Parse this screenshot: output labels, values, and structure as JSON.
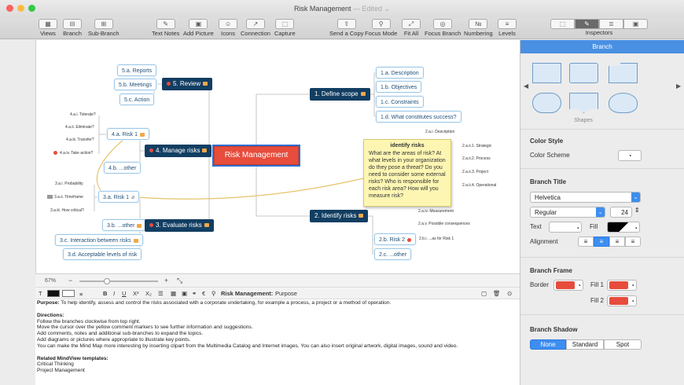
{
  "window": {
    "title": "Risk Management",
    "edited": "— Edited ⌄"
  },
  "toolbar": {
    "left": [
      {
        "id": "views",
        "label": "Views",
        "icon": "▦"
      },
      {
        "id": "branch",
        "label": "Branch",
        "icon": "⊟"
      },
      {
        "id": "sub-branch",
        "label": "Sub-Branch",
        "icon": "⊞"
      }
    ],
    "mid": [
      {
        "id": "text-notes",
        "label": "Text Notes",
        "icon": "✎"
      },
      {
        "id": "add-picture",
        "label": "Add Picture",
        "icon": "▣"
      },
      {
        "id": "icons",
        "label": "Icons",
        "icon": "☺"
      },
      {
        "id": "connection",
        "label": "Connection",
        "icon": "↗"
      },
      {
        "id": "capture",
        "label": "Capture",
        "icon": "⬚"
      }
    ],
    "right": [
      {
        "id": "send-copy",
        "label": "Send a Copy",
        "icon": "⇪"
      },
      {
        "id": "focus-mode",
        "label": "Focus Mode",
        "icon": "⚲"
      },
      {
        "id": "fit-all",
        "label": "Fit All",
        "icon": "⤢"
      },
      {
        "id": "focus-branch",
        "label": "Focus Branch",
        "icon": "◎"
      },
      {
        "id": "numbering",
        "label": "Numbering",
        "icon": "№"
      },
      {
        "id": "levels",
        "label": "Levels",
        "icon": "≡"
      }
    ],
    "inspectors": {
      "label": "Inspectors",
      "icons": [
        "⬚",
        "✎",
        "≣",
        "▣"
      ]
    }
  },
  "map": {
    "central": "Risk Management",
    "main_branches": {
      "b5": "5.  Review",
      "b1": "1.  Define scope",
      "b4": "4.  Manage risks",
      "b2": "2.  Identify risks",
      "b3": "3.  Evaluate risks"
    },
    "subs": {
      "s5a": "5.a.  Reports",
      "s5b": "5.b.  Meetings",
      "s5c": "5.c.  Action",
      "s1a": "1.a.  Description",
      "s1b": "1.b.  Objectives",
      "s1c": "1.c.  Constraints",
      "s1d": "1.d.  What constitutes success?",
      "s4a": "4.a.  Risk 1",
      "s4b": "4.b.  ...other",
      "s3a": "3.a.  Risk 1",
      "s3b": "3.b.  ...other",
      "s3c": "3.c.  Interaction between risks",
      "s3d": "3.d.  Acceptable levels of risk",
      "s2b": "2.b.  Risk 2",
      "s2c": "2.c.  ...other"
    },
    "tiny": {
      "t4ai": "4.a.i.  Tolerate?",
      "t4aii": "4.a.ii.  Eliminate?",
      "t4aiii": "4.a.iii.  Transfer?",
      "t4aiv": "4.a.iv.  Take action?",
      "t3ai": "3.a.i.  Probability",
      "t3aii": "3.a.ii.  Timeframe",
      "t3aiii": "3.a.iii.  How critical?",
      "t2ai": "2.a.i.  Description",
      "t2aii1": "2.a.ii.1. Strategic",
      "t2aii2": "2.a.ii.2. Process",
      "t2aii3": "2.a.ii.3. Project",
      "t2aii4": "2.a.ii.4. Operational",
      "t2aiv": "2.a.iv.  Measurement",
      "t2av": "2.a.v.  Possible consequences",
      "t2bi": "2.b.i.  ...as for Risk 1"
    },
    "note": {
      "title": "identify risks",
      "body": "What are the areas of risk? At what levels in your organization do they pose a threat? Do you need to consider some external risks? Who is responsible for each risk area? How will you measure risk?"
    }
  },
  "zoom": {
    "level": "67%"
  },
  "format_bar": {
    "font_button": "T",
    "bold": "B",
    "italic": "I",
    "underline": "U",
    "superscript": "X²",
    "subscript": "X₂",
    "topic": "Risk Management:",
    "field": "Purpose"
  },
  "notes": {
    "purpose_label": "Purpose:",
    "purpose_text": " To help identify, assess and control the risks associated with a corporate undertaking, for example a process, a project or a method of operation.",
    "directions_label": "Directions:",
    "directions": [
      "Follow the branches clockwise from top right.",
      "Move the cursor over the yellow comment markers to see further information and suggestions.",
      "Add comments, notes and additional sub-branches to expand the topics.",
      "Add diagrams or pictures where appropriate to illustrate key points.",
      "You can make the Mind Map more interesting by inserting clipart from the Multimedia Catalog and Internet images. You can also insert original artwork, digital images, sound and video."
    ],
    "related_label": "Related MindView templates:",
    "related": [
      "Critical Thinking",
      "Project Management"
    ]
  },
  "inspector": {
    "tab": "Branch",
    "shapes_label": "Shapes",
    "color_style": {
      "heading": "Color Style",
      "scheme_label": "Color Scheme"
    },
    "branch_title": {
      "heading": "Branch Title",
      "font": "Helvetica",
      "style": "Regular",
      "size": "24",
      "text_label": "Text",
      "fill_label": "Fill",
      "alignment_label": "Alignment"
    },
    "branch_frame": {
      "heading": "Branch Frame",
      "border_label": "Border",
      "fill1_label": "Fill 1",
      "fill2_label": "Fill 2"
    },
    "branch_shadow": {
      "heading": "Branch Shadow",
      "options": [
        "None",
        "Standard",
        "Spot"
      ],
      "selected": "None"
    }
  },
  "colors": {
    "accent": "#4a90e2",
    "central": "#e74c3c",
    "branch": "#123e62",
    "swatch_red": "#e74c3c",
    "note_yellow": "#fdf6b3"
  }
}
